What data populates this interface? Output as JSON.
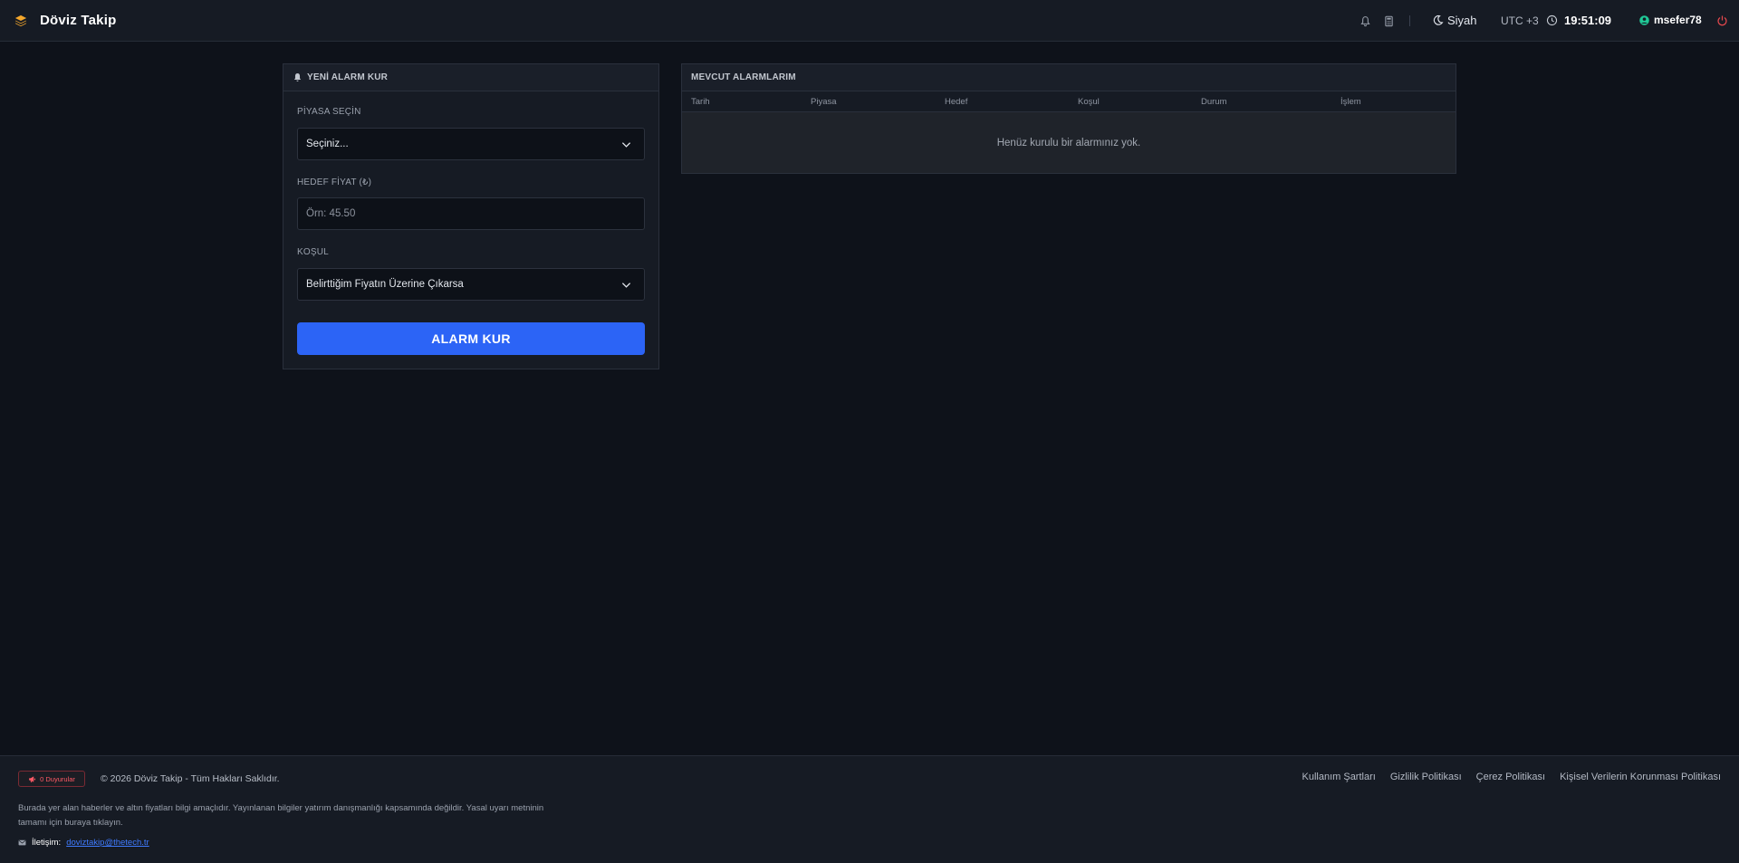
{
  "header": {
    "brand_title": "Döviz Takip",
    "brand_icon": "layers-icon",
    "theme_label": "Siyah",
    "timezone": "UTC +3",
    "time": "19:51:09",
    "username": "msefer78",
    "colors": {
      "accent": "#f4a72c",
      "user_status": "#20c997",
      "power": "#e5484d"
    }
  },
  "alarm_form": {
    "title": "YENİ ALARM KUR",
    "market_label": "PİYASA SEÇİN",
    "market_value": "Seçiniz...",
    "price_label": "HEDEF FİYAT (₺)",
    "price_placeholder": "Örn: 45.50",
    "condition_label": "KOŞUL",
    "condition_value": "Belirttiğim Fiyatın Üzerine Çıkarsa",
    "submit_label": "ALARM KUR",
    "colors": {
      "button": "#2c64f6"
    }
  },
  "alarms_table": {
    "title": "MEVCUT ALARMLARIM",
    "columns": [
      "Tarih",
      "Piyasa",
      "Hedef",
      "Koşul",
      "Durum",
      "İşlem"
    ],
    "empty_message": "Henüz kurulu bir alarmınız yok."
  },
  "footer": {
    "announcements_badge": "0 Duyurular",
    "copyright": "© 2026 Döviz Takip - Tüm Hakları Saklıdır.",
    "links": [
      "Kullanım Şartları",
      "Gizlilik Politikası",
      "Çerez Politikası",
      "Kişisel Verilerin Korunması Politikası"
    ],
    "disclaimer": "Burada yer alan haberler ve altın fiyatları bilgi amaçlıdır. Yayınlanan bilgiler yatırım danışmanlığı kapsamında değildir. Yasal uyarı metninin tamamı için buraya tıklayın.",
    "contact_label": "İletişim:",
    "contact_email": "doviztakip@thetech.tr"
  }
}
